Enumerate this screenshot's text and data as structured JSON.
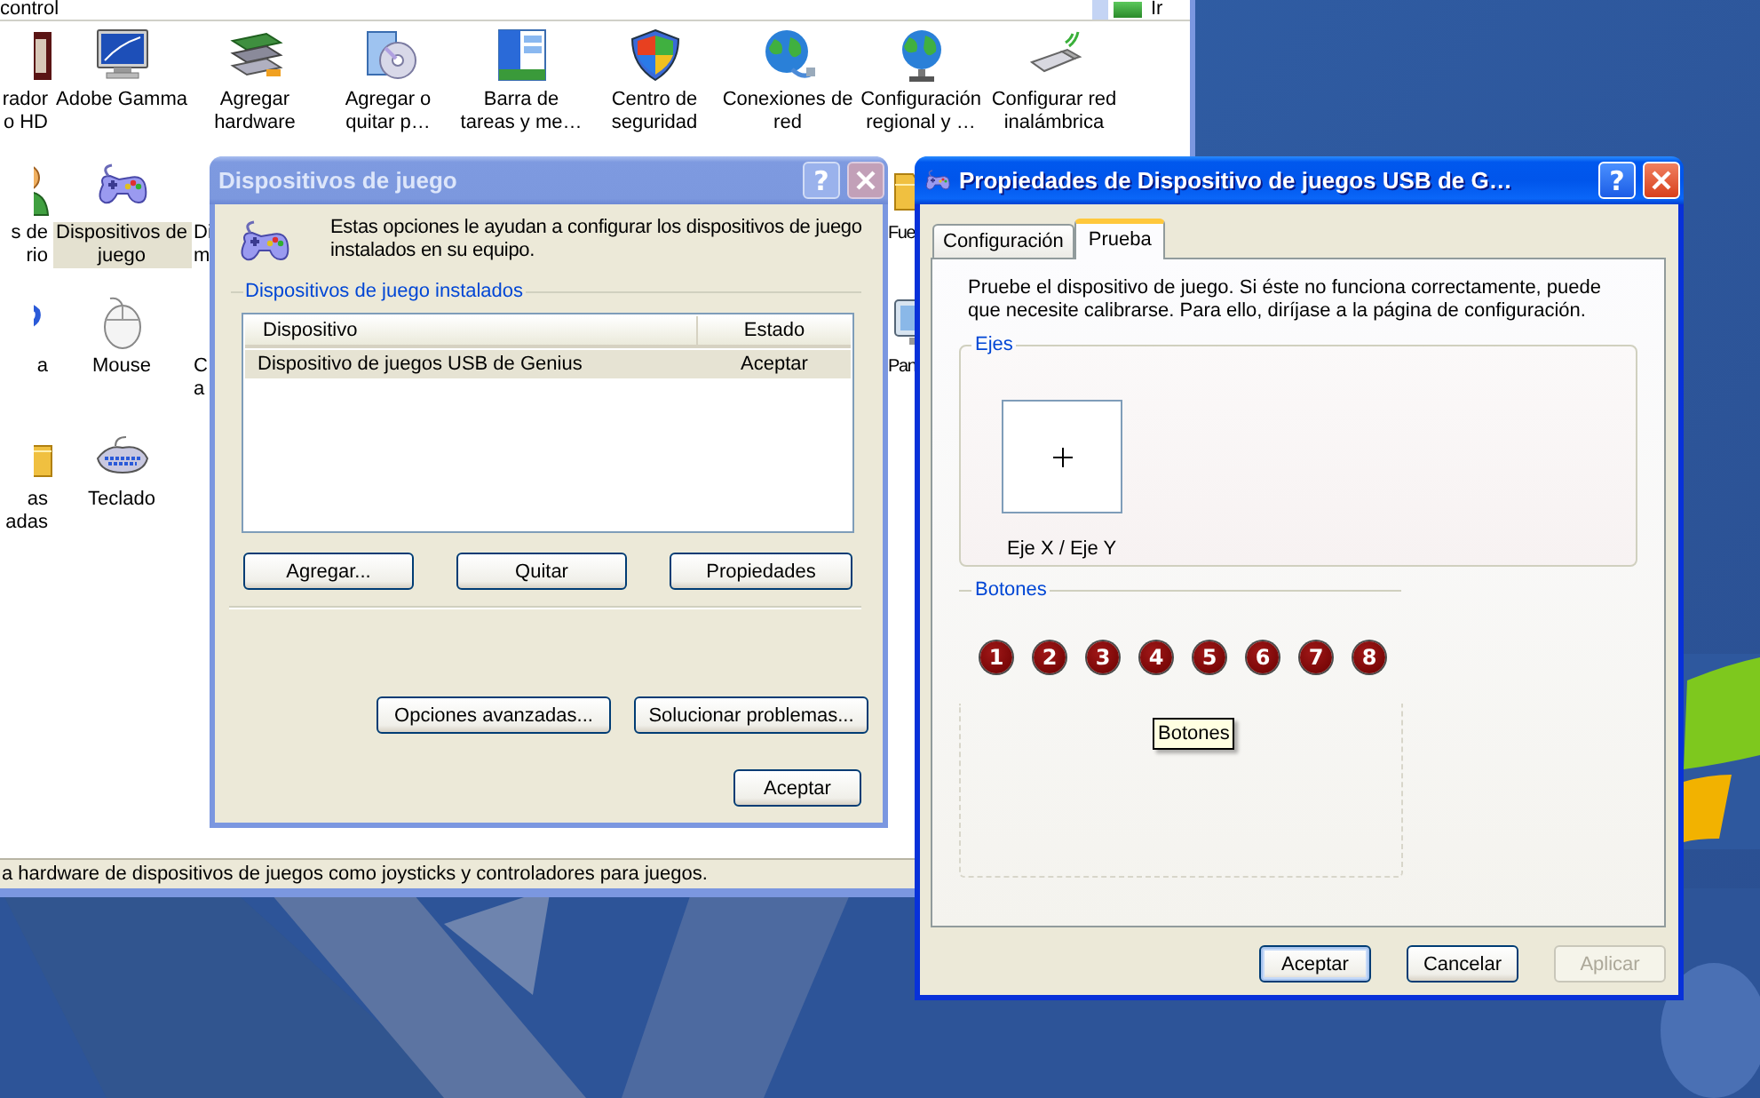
{
  "control_panel": {
    "address": "control",
    "go_label": "Ir",
    "icon_rows": [
      {
        "left_items": [
          {
            "label": "rador\no HD",
            "kind": "device",
            "selected": false
          },
          {
            "label": "Adobe Gamma",
            "kind": "monitor",
            "selected": false
          },
          {
            "label": "Agregar\nhardware",
            "kind": "hardware",
            "selected": false
          },
          {
            "label": "Agregar o\nquitar p…",
            "kind": "installer",
            "selected": false
          },
          {
            "label": "Barra de\ntareas y me…",
            "kind": "taskbar",
            "selected": false
          },
          {
            "label": "Centro de\nseguridad",
            "kind": "shield",
            "selected": false
          },
          {
            "label": "Conexiones de\nred",
            "kind": "network",
            "selected": false
          },
          {
            "label": "Configuración\nregional y …",
            "kind": "globe",
            "selected": false
          },
          {
            "label": "Configurar red\ninalámbrica",
            "kind": "wireless",
            "selected": false
          }
        ],
        "right_items": []
      },
      {
        "left_items": [
          {
            "label": "s de\nrio",
            "kind": "user",
            "selected": false
          },
          {
            "label": "Dispositivos de\njuego",
            "kind": "gamepad",
            "selected": true
          },
          {
            "label": "Di\nm",
            "kind": "none",
            "selected": false
          }
        ],
        "right_items": [
          {
            "label": "Fue",
            "kind": "folder",
            "selected": false
          }
        ]
      },
      {
        "left_items": [
          {
            "label": "a",
            "kind": "help",
            "selected": false
          },
          {
            "label": "Mouse",
            "kind": "mouse",
            "selected": false
          },
          {
            "label": "C\na",
            "kind": "none",
            "selected": false
          }
        ],
        "right_items": [
          {
            "label": "Pan",
            "kind": "screen",
            "selected": false
          }
        ]
      },
      {
        "left_items": [
          {
            "label": "as\nadas",
            "kind": "folder",
            "selected": false
          },
          {
            "label": "Teclado",
            "kind": "keyboard",
            "selected": false
          }
        ],
        "right_items": []
      }
    ],
    "status_bar": "a hardware de dispositivos de juegos como joysticks y controladores para juegos."
  },
  "game_dialog": {
    "title": "Dispositivos de juego",
    "active": false,
    "help_button": "?",
    "intro": "Estas opciones le ayudan a configurar los dispositivos de juego\ninstalados en su equipo.",
    "group_label": "Dispositivos de juego instalados",
    "columns": [
      "Dispositivo",
      "Estado"
    ],
    "rows": [
      {
        "cells": [
          "Dispositivo de juegos USB de Genius",
          "Aceptar"
        ],
        "selected": true
      }
    ],
    "buttons": [
      "Agregar...",
      "Quitar",
      "Propiedades"
    ],
    "lower_buttons": [
      "Opciones avanzadas...",
      "Solucionar problemas..."
    ],
    "ok_button": "Aceptar"
  },
  "props_dialog": {
    "title": "Propiedades de Dispositivo de juegos USB de G…",
    "active": true,
    "help_button": "?",
    "tabs": [
      {
        "label": "Configuración",
        "selected": false
      },
      {
        "label": "Prueba",
        "selected": true
      }
    ],
    "description": "Pruebe el dispositivo de juego. Si éste no funciona correctamente, puede\nque necesite calibrarse. Para ello, diríjase a la página de configuración.",
    "axes_label": "Ejes",
    "axis_caption": "Eje X / Eje Y",
    "buttons_label": "Botones",
    "joystick_buttons": [
      "1",
      "2",
      "3",
      "4",
      "5",
      "6",
      "7",
      "8"
    ],
    "tooltip": "Botones",
    "footer_buttons": [
      {
        "label": "Aceptar",
        "default": true,
        "disabled": false
      },
      {
        "label": "Cancelar",
        "default": false,
        "disabled": false
      },
      {
        "label": "Aplicar",
        "default": false,
        "disabled": true
      }
    ]
  }
}
